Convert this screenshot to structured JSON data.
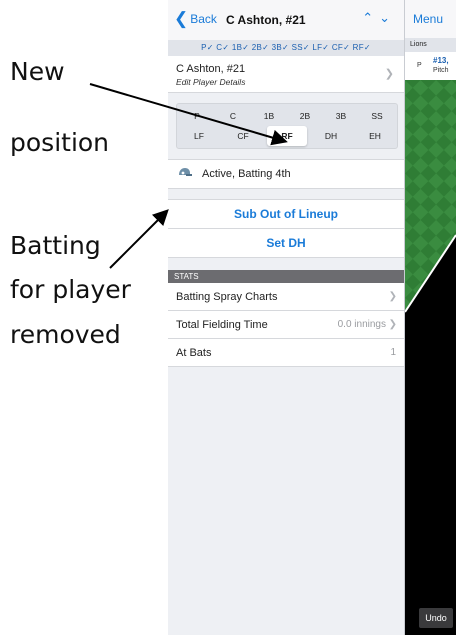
{
  "annotations": {
    "new_line1": "New",
    "new_line2": "position",
    "batting_line1": "Batting",
    "batting_line2": "for player",
    "batting_line3": "removed"
  },
  "player_panel": {
    "back_label": "Back",
    "title": "C Ashton, #21",
    "position_summary": "P✓ C✓ 1B✓ 2B✓ 3B✓ SS✓ LF✓ CF✓ RF✓",
    "edit_name": "C Ashton, #21",
    "edit_sub": "Edit Player Details",
    "positions_row1": [
      "P",
      "C",
      "1B",
      "2B",
      "3B",
      "SS"
    ],
    "positions_row2": [
      "LF",
      "CF",
      "RF",
      "DH",
      "EH"
    ],
    "selected_position": "RF",
    "status_text": "Active, Batting 4th",
    "sub_out_label": "Sub Out of Lineup",
    "set_dh_label": "Set DH",
    "stats_header": "STATS",
    "stats": {
      "spray_label": "Batting Spray Charts",
      "fielding_label": "Total Fielding Time",
      "fielding_value": "0.0 innings",
      "at_bats_label": "At Bats",
      "at_bats_value": "1"
    }
  },
  "right_panel": {
    "menu_label": "Menu",
    "team": "Lions",
    "card_pos": "P",
    "card_number": "#13,",
    "card_role": "Pitch",
    "undo_label": "Undo"
  },
  "colors": {
    "accent": "#1a7bd8",
    "selected_pos_bg": "#ffffff",
    "field_green": "#2f7d35"
  },
  "icons": {
    "helmet": "batting-helmet-icon",
    "back": "chevron-left-icon",
    "up": "chevron-up-icon",
    "down": "chevron-down-icon"
  }
}
